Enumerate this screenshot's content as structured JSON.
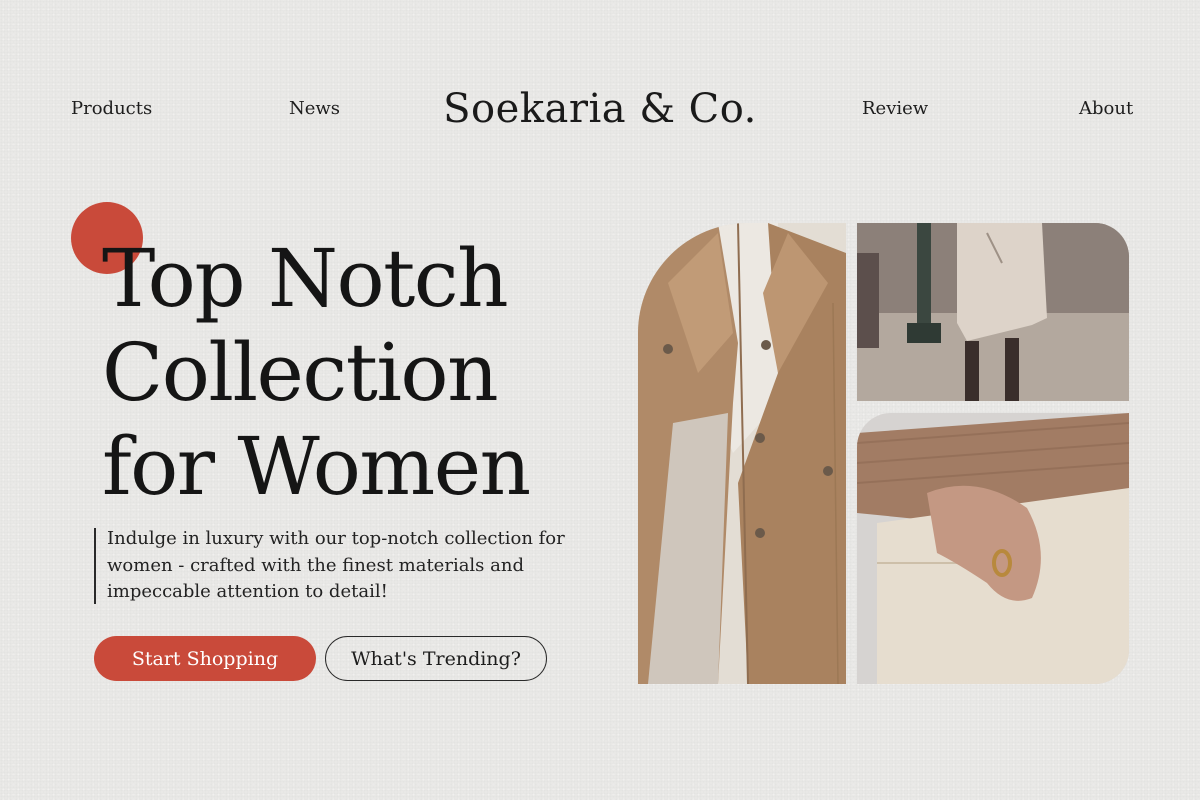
{
  "nav": {
    "left": [
      "Products",
      "News"
    ],
    "brand": "Soekaria & Co.",
    "right": [
      "Review",
      "About"
    ]
  },
  "hero": {
    "headline": [
      "Top Notch",
      "Collection",
      "for Women"
    ],
    "description": "Indulge in luxury with our top-notch collection for women - crafted with the finest materials and impeccable attention to detail!",
    "primary_button": "Start Shopping",
    "secondary_button": "What's Trending?"
  },
  "colors": {
    "accent": "#c94a3a",
    "background": "#e9e8e6",
    "text": "#161616"
  },
  "images": [
    {
      "name": "coat-photo",
      "depicts": "woman in camel trench coat"
    },
    {
      "name": "street-photo",
      "depicts": "woman in beige coat on street"
    },
    {
      "name": "pocket-photo",
      "depicts": "hand with gold ring in cream trouser pocket"
    }
  ]
}
